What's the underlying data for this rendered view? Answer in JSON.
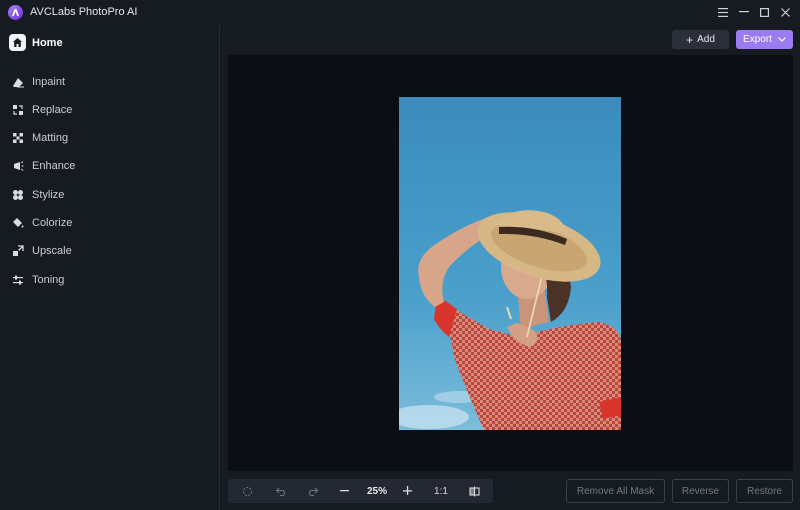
{
  "titlebar": {
    "app_name": "AVCLabs PhotoPro AI",
    "menu_icon": "hamburger-icon",
    "minimize_icon": "minimize-icon",
    "maximize_icon": "maximize-icon",
    "close_icon": "close-icon"
  },
  "sidebar": {
    "home_label": "Home",
    "items": [
      {
        "label": "Inpaint",
        "icon": "eraser-icon"
      },
      {
        "label": "Replace",
        "icon": "replace-icon"
      },
      {
        "label": "Matting",
        "icon": "matting-icon"
      },
      {
        "label": "Enhance",
        "icon": "enhance-icon"
      },
      {
        "label": "Stylize",
        "icon": "stylize-icon"
      },
      {
        "label": "Colorize",
        "icon": "colorize-icon"
      },
      {
        "label": "Upscale",
        "icon": "upscale-icon"
      },
      {
        "label": "Toning",
        "icon": "toning-icon"
      }
    ]
  },
  "header": {
    "add_label": "Add",
    "export_label": "Export"
  },
  "toolbar": {
    "zoom": "25%",
    "ratio": "1:1"
  },
  "actions": {
    "remove_all_mask": "Remove All Mask",
    "reverse": "Reverse",
    "restore": "Restore"
  },
  "colors": {
    "accent": "#9b7cf0",
    "background": "#161a21",
    "canvas": "#0b0e13"
  }
}
